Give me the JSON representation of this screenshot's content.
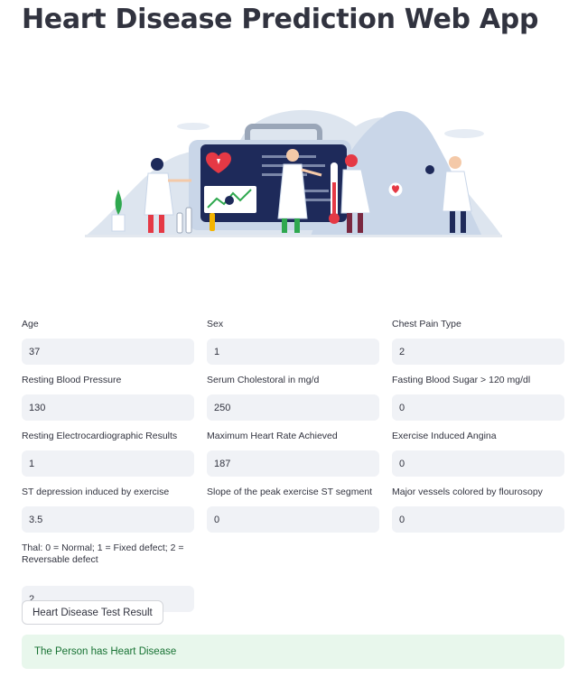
{
  "app": {
    "title": "Heart Disease Prediction Web App"
  },
  "illustration": {
    "description_icon": "doctors-heart-illustration",
    "colors": {
      "navy": "#1e2a5a",
      "red": "#e53945",
      "light_blue": "#c9d6e8",
      "green": "#2fa84f"
    }
  },
  "fields": [
    {
      "label": "Age",
      "value": "37"
    },
    {
      "label": "Sex",
      "value": "1"
    },
    {
      "label": "Chest Pain Type",
      "value": "2"
    },
    {
      "label": "Resting Blood Pressure",
      "value": "130"
    },
    {
      "label": "Serum Cholestoral in mg/d",
      "value": "250"
    },
    {
      "label": "Fasting Blood Sugar > 120 mg/dl",
      "value": "0"
    },
    {
      "label": "Resting Electrocardiographic Results",
      "value": "1"
    },
    {
      "label": "Maximum Heart Rate Achieved",
      "value": "187"
    },
    {
      "label": "Exercise Induced Angina",
      "value": "0"
    },
    {
      "label": "ST depression induced by exercise",
      "value": "3.5"
    },
    {
      "label": "Slope of the peak exercise ST segment",
      "value": "0"
    },
    {
      "label": "Major vessels colored by flourosopy",
      "value": "0"
    },
    {
      "label": "Thal: 0 = Normal; 1 = Fixed defect; 2 = Reversable defect",
      "value": "2"
    }
  ],
  "button": {
    "label": "Heart Disease Test Result"
  },
  "result": {
    "message": "The Person has Heart Disease",
    "color": "#177233",
    "background": "#e8f7ec"
  }
}
